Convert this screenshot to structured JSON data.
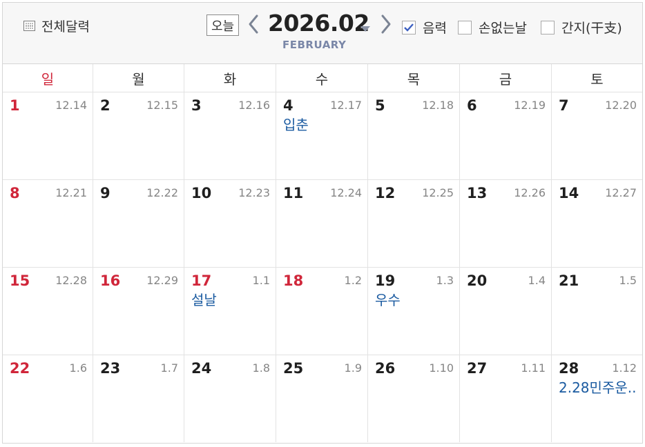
{
  "header": {
    "full_calendar_label": "전체달력",
    "today_label": "오늘",
    "year_month": "2026.02",
    "month_english": "FEBRUARY",
    "options": [
      {
        "label": "음력",
        "checked": true
      },
      {
        "label": "손없는날",
        "checked": false
      },
      {
        "label": "간지(干支)",
        "checked": false
      }
    ]
  },
  "weekdays": [
    "일",
    "월",
    "화",
    "수",
    "목",
    "금",
    "토"
  ],
  "weeks": [
    [
      {
        "day": "1",
        "lunar": "12.14",
        "event": "",
        "red": true
      },
      {
        "day": "2",
        "lunar": "12.15",
        "event": "",
        "red": false
      },
      {
        "day": "3",
        "lunar": "12.16",
        "event": "",
        "red": false
      },
      {
        "day": "4",
        "lunar": "12.17",
        "event": "입춘",
        "red": false
      },
      {
        "day": "5",
        "lunar": "12.18",
        "event": "",
        "red": false
      },
      {
        "day": "6",
        "lunar": "12.19",
        "event": "",
        "red": false
      },
      {
        "day": "7",
        "lunar": "12.20",
        "event": "",
        "red": false
      }
    ],
    [
      {
        "day": "8",
        "lunar": "12.21",
        "event": "",
        "red": true
      },
      {
        "day": "9",
        "lunar": "12.22",
        "event": "",
        "red": false
      },
      {
        "day": "10",
        "lunar": "12.23",
        "event": "",
        "red": false
      },
      {
        "day": "11",
        "lunar": "12.24",
        "event": "",
        "red": false
      },
      {
        "day": "12",
        "lunar": "12.25",
        "event": "",
        "red": false
      },
      {
        "day": "13",
        "lunar": "12.26",
        "event": "",
        "red": false
      },
      {
        "day": "14",
        "lunar": "12.27",
        "event": "",
        "red": false
      }
    ],
    [
      {
        "day": "15",
        "lunar": "12.28",
        "event": "",
        "red": true
      },
      {
        "day": "16",
        "lunar": "12.29",
        "event": "",
        "red": true
      },
      {
        "day": "17",
        "lunar": "1.1",
        "event": "설날",
        "red": true
      },
      {
        "day": "18",
        "lunar": "1.2",
        "event": "",
        "red": true
      },
      {
        "day": "19",
        "lunar": "1.3",
        "event": "우수",
        "red": false
      },
      {
        "day": "20",
        "lunar": "1.4",
        "event": "",
        "red": false
      },
      {
        "day": "21",
        "lunar": "1.5",
        "event": "",
        "red": false
      }
    ],
    [
      {
        "day": "22",
        "lunar": "1.6",
        "event": "",
        "red": true
      },
      {
        "day": "23",
        "lunar": "1.7",
        "event": "",
        "red": false
      },
      {
        "day": "24",
        "lunar": "1.8",
        "event": "",
        "red": false
      },
      {
        "day": "25",
        "lunar": "1.9",
        "event": "",
        "red": false
      },
      {
        "day": "26",
        "lunar": "1.10",
        "event": "",
        "red": false
      },
      {
        "day": "27",
        "lunar": "1.11",
        "event": "",
        "red": false
      },
      {
        "day": "28",
        "lunar": "1.12",
        "event": "2.28민주운..",
        "red": false
      }
    ]
  ],
  "colors": {
    "holiday": "#d0263a",
    "event": "#1a5aa0",
    "check": "#3b5fc0"
  }
}
